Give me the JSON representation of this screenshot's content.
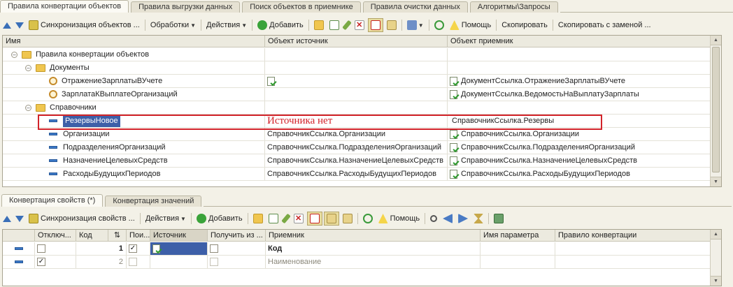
{
  "top_tabs": [
    "Правила конвертации объектов",
    "Правила выгрузки данных",
    "Поиск объектов в приемнике",
    "Правила очистки данных",
    "Алгоритмы\\Запросы"
  ],
  "toolbar1": {
    "sync": "Синхронизация объектов ...",
    "processing": "Обработки",
    "actions": "Действия",
    "add": "Добавить",
    "help": "Помощь",
    "copy": "Скопировать",
    "copy_replace": "Скопировать с заменой ..."
  },
  "grid1": {
    "columns": [
      "Имя",
      "Объект источник",
      "Объект приемник"
    ],
    "rows": [
      {
        "name": "Правила конвертации объектов",
        "source": "",
        "target": ""
      },
      {
        "name": "Документы",
        "source": "",
        "target": ""
      },
      {
        "name": "ОтражениеЗарплатыВУчете",
        "source": "",
        "target": "ДокументСсылка.ОтражениеЗарплатыВУчете"
      },
      {
        "name": "ЗарплатаКВыплатеОрганизаций",
        "source": "",
        "target": "ДокументСсылка.ВедомостьНаВыплатуЗарплаты"
      },
      {
        "name": "Справочники",
        "source": "",
        "target": ""
      },
      {
        "name": "РезервыНовое",
        "source": "Источника нет",
        "target": "СправочникСсылка.Резервы"
      },
      {
        "name": "Организации",
        "source": "СправочникСсылка.Организации",
        "target": "СправочникСсылка.Организации"
      },
      {
        "name": "ПодразделенияОрганизаций",
        "source": "СправочникСсылка.ПодразделенияОрганизаций",
        "target": "СправочникСсылка.ПодразделенияОрганизаций"
      },
      {
        "name": "НазначениеЦелевыхСредств",
        "source": "СправочникСсылка.НазначениеЦелевыхСредств",
        "target": "СправочникСсылка.НазначениеЦелевыхСредств"
      },
      {
        "name": "РасходыБудущихПериодов",
        "source": "СправочникСсылка.РасходыБудущихПериодов",
        "target": "СправочникСсылка.РасходыБудущихПериодов"
      }
    ]
  },
  "bottom_tabs": [
    "Конвертация свойств (*)",
    "Конвертация значений"
  ],
  "toolbar2": {
    "sync": "Синхронизация свойств ...",
    "actions": "Действия",
    "add": "Добавить",
    "help": "Помощь"
  },
  "grid2": {
    "columns": [
      "Отключ...",
      "Код",
      "",
      "Пои...",
      "Источник",
      "Получить из ...",
      "Приемник",
      "Имя параметра",
      "Правило конвертации"
    ],
    "rows": [
      {
        "code": "1",
        "target": "Код"
      },
      {
        "code": "2",
        "target": "Наименование"
      }
    ]
  }
}
